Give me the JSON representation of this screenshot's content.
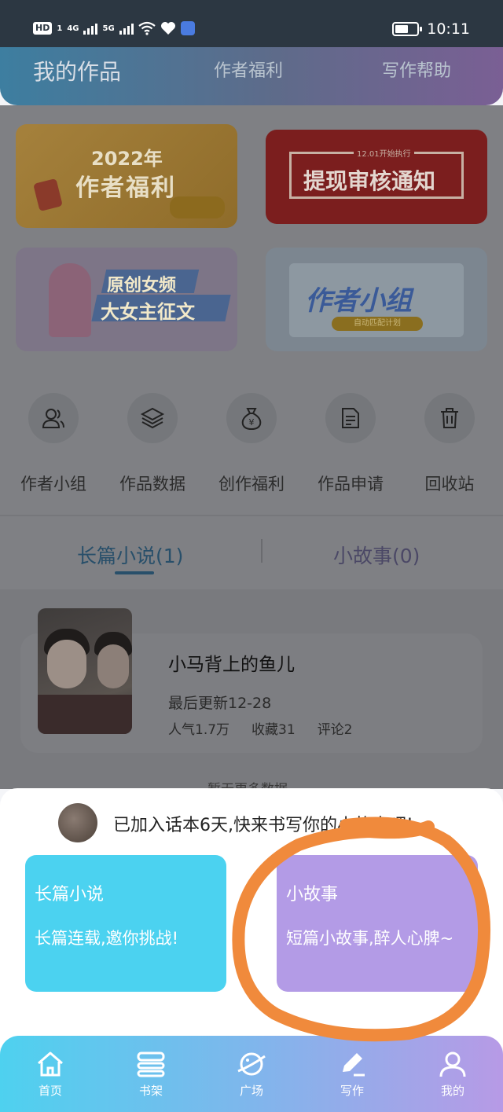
{
  "status_bar": {
    "hd": "HD",
    "sim": "1",
    "net1": "4G",
    "net2": "5G",
    "time": "10:11"
  },
  "header": {
    "tabs": [
      "我的作品",
      "作者福利",
      "写作帮助"
    ]
  },
  "banners": {
    "welfare_year": "2022年",
    "welfare_title": "作者福利",
    "withdraw_small": "12.01开始执行",
    "withdraw_title": "提现审核通知",
    "contest_line1": "原创女频",
    "contest_line2": "大女主征文",
    "group_title": "作者小组",
    "group_sub": "自动匹配计划"
  },
  "features": [
    {
      "label": "作者小组",
      "icon": "people-icon"
    },
    {
      "label": "作品数据",
      "icon": "layers-icon"
    },
    {
      "label": "创作福利",
      "icon": "money-bag-icon"
    },
    {
      "label": "作品申请",
      "icon": "document-icon"
    },
    {
      "label": "回收站",
      "icon": "trash-icon"
    }
  ],
  "works_tabs": {
    "long": "长篇小说(1)",
    "short": "小故事(0)"
  },
  "book": {
    "title": "小马背上的鱼儿",
    "updated": "最后更新12-28",
    "popularity": "人气1.7万",
    "favorites": "收藏31",
    "comments": "评论2"
  },
  "list_footer": "暂无更多数据",
  "sheet": {
    "notice": "已加入话本6天,快来书写你的小故事吧!",
    "long": {
      "title": "长篇小说",
      "desc": "长篇连载,邀你挑战!"
    },
    "short": {
      "title": "小故事",
      "desc": "短篇小故事,醉人心脾~"
    }
  },
  "tabbar": [
    {
      "label": "首页",
      "icon": "home-icon"
    },
    {
      "label": "书架",
      "icon": "bookshelf-icon"
    },
    {
      "label": "广场",
      "icon": "planet-icon"
    },
    {
      "label": "写作",
      "icon": "pen-icon"
    },
    {
      "label": "我的",
      "icon": "user-icon"
    }
  ],
  "colors": {
    "accent_cyan": "#4bd2f0",
    "accent_purple": "#b39be6",
    "annotation_orange": "#f08a3c"
  }
}
